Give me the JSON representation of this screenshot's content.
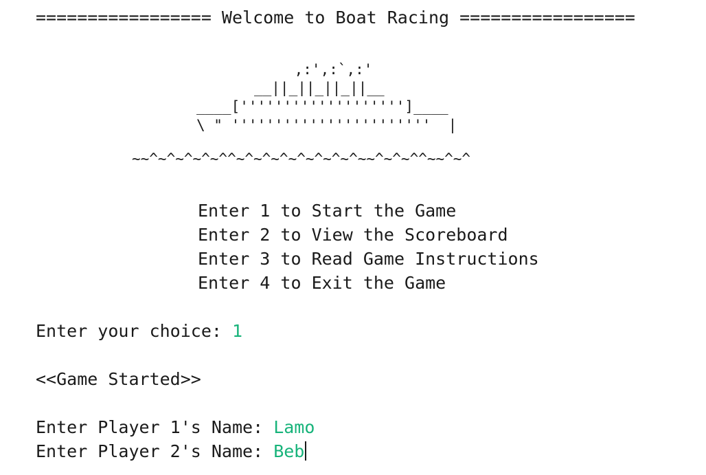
{
  "console": {
    "banner": "================= Welcome to Boat Racing =================",
    "art": {
      "line1": " ,:',:`,:'",
      "line2": "__||_||_||_||__",
      "line3": "____[''''''''''''''''''']____",
      "line4": "\\ \" '''''''''''''''''''''''  |",
      "line5": "~~^~^~^~^~^^~^~^~^~^~^~^~^~~^~^~^^~~^~^"
    },
    "menu": [
      "Enter 1 to Start the Game",
      "Enter 2 to View the Scoreboard",
      "Enter 3 to Read Game Instructions",
      "Enter 4 to Exit the Game"
    ],
    "choice_prompt": "Enter your choice: ",
    "choice_value": "1",
    "status": "<<Game Started>>",
    "player1_prompt": "Enter Player 1's Name: ",
    "player1_value": "Lamo",
    "player2_prompt": "Enter Player 2's Name: ",
    "player2_value": "Beb"
  },
  "colors": {
    "text": "#1a1a1a",
    "user_input": "#17b37a",
    "background": "#ffffff"
  }
}
